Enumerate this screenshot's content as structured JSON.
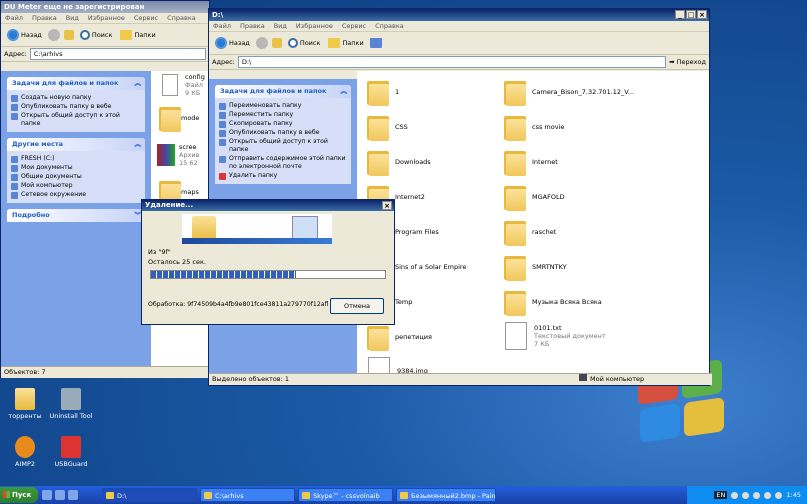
{
  "colors": {
    "accent": "#0a246a",
    "taskbar": "#245edb",
    "folder": "#f0c84a"
  },
  "bg_window": {
    "title": "DU Meter еще не зарегистрирован",
    "menu": [
      "Файл",
      "Правка",
      "Вид",
      "Избранное",
      "Сервис",
      "Справка"
    ],
    "toolbar": {
      "back": "Назад",
      "search": "Поиск",
      "folders": "Папки"
    },
    "address_label": "Адрес:",
    "address": "C:\\arhivs",
    "tasks_title": "Задачи для файлов и папок",
    "tasks": [
      "Создать новую папку",
      "Опубликовать папку в вебе",
      "Открыть общий доступ к этой папке"
    ],
    "places_title": "Другие места",
    "places": [
      "FRESH (C:)",
      "Мои документы",
      "Общие документы",
      "Мой компьютер",
      "Сетевое окружение"
    ],
    "details_title": "Подробно",
    "files": [
      {
        "name": "config",
        "sub": "Файл",
        "size": "9 КБ"
      },
      {
        "name": "mode"
      },
      {
        "name": "scree",
        "sub": "Архив",
        "size": "15 62"
      },
      {
        "name": "maps"
      }
    ],
    "status": "Объектов: 7"
  },
  "fg_window": {
    "title": "D:\\",
    "menu": [
      "Файл",
      "Правка",
      "Вид",
      "Избранное",
      "Сервис",
      "Справка"
    ],
    "toolbar": {
      "back": "Назад",
      "search": "Поиск",
      "folders": "Папки"
    },
    "address_label": "Адрес:",
    "address": "D:\\",
    "go": "Переход",
    "tasks_title": "Задачи для файлов и папок",
    "tasks": [
      "Переименовать папку",
      "Переместить папку",
      "Скопировать папку",
      "Опубликовать папку в вебе",
      "Открыть общий доступ к этой папке",
      "Отправить содержимое этой папки по электронной почте",
      "Удалить папку"
    ],
    "left_items": [
      "1",
      "CSS",
      "Downloads",
      "Internet2",
      "Program Files",
      "Sins of a Solar Empire",
      "Temp",
      "репетиция",
      "9384.img"
    ],
    "right_items": [
      {
        "name": "Camera_Bison_7.32.701.12_V..."
      },
      {
        "name": "css movie"
      },
      {
        "name": "Internet"
      },
      {
        "name": "MGAFOLD"
      },
      {
        "name": "raschet"
      },
      {
        "name": "SMRTNTKY"
      },
      {
        "name": "Музыка Всяка Всяка"
      },
      {
        "name": "0101.txt",
        "sub": "Текстовый документ",
        "size": "7 КБ",
        "file": true
      }
    ],
    "status_left": "Выделено объектов: 1",
    "status_right": "Мой компьютер"
  },
  "dialog": {
    "title": "Удаление...",
    "from": "Из \"9f\"",
    "remaining": "Осталось 25 сек.",
    "progress": 0.62,
    "processing_label": "Обработка:",
    "processing_value": "9f74509b4a4fb9e801fce43811a279770f12afl",
    "cancel": "Отмена"
  },
  "desktop_icons": [
    "торренты",
    "Uninstall Tool",
    "AIMP2",
    "USBGuard"
  ],
  "taskbar": {
    "start": "Пуск",
    "tasks": [
      "D:\\",
      "C:\\arhivs",
      "Skype™ - cssvolnaib",
      "Безымянный2.bmp - Paint"
    ],
    "lang": "EN",
    "clock": "1:45"
  }
}
